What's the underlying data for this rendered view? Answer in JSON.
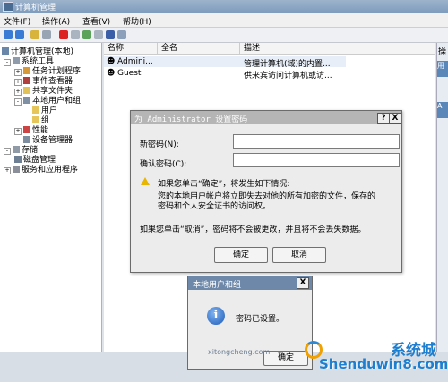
{
  "window": {
    "title": "计算机管理"
  },
  "menu": [
    "文件(F)",
    "操作(A)",
    "查看(V)",
    "帮助(H)"
  ],
  "tree": {
    "root": "计算机管理(本地)",
    "system_tools": "系统工具",
    "task_scheduler": "任务计划程序",
    "event_viewer": "事件查看器",
    "shared_folders": "共享文件夹",
    "local_users": "本地用户和组",
    "users": "用户",
    "groups": "组",
    "performance": "性能",
    "device_manager": "设备管理器",
    "storage": "存储",
    "disk_management": "磁盘管理",
    "services": "服务和应用程序"
  },
  "list": {
    "headers": [
      "名称",
      "全名",
      "描述"
    ],
    "rows": [
      {
        "name": "Admini...",
        "fullname": "",
        "desc": "管理计算机(域)的内置..."
      },
      {
        "name": "Guest",
        "fullname": "",
        "desc": "供来宾访问计算机或访..."
      }
    ]
  },
  "actions": {
    "header": "操",
    "items": [
      "用",
      "A"
    ]
  },
  "password_dialog": {
    "title": "为 Administrator 设置密码",
    "help_btn": "?",
    "close_btn": "X",
    "new_pw_label": "新密码(N):",
    "confirm_pw_label": "确认密码(C):",
    "warn_line1": "如果您单击“确定”，将发生如下情况:",
    "warn_line2": "您的本地用户帐户将立即失去对他的所有加密的文件，保存的",
    "warn_line3": "密码和个人安全证书的访问权。",
    "cancel_note": "如果您单击“取消”，密码将不会被更改，并且将不会丢失数据。",
    "ok": "确定",
    "cancel": "取消"
  },
  "msg_dialog": {
    "title": "本地用户和组",
    "close_btn": "X",
    "text": "密码已设置。",
    "ok": "确定"
  },
  "watermark": {
    "line1": "Shenduwin8.com",
    "line2": "xitongcheng.com",
    "logo": "系统城"
  }
}
